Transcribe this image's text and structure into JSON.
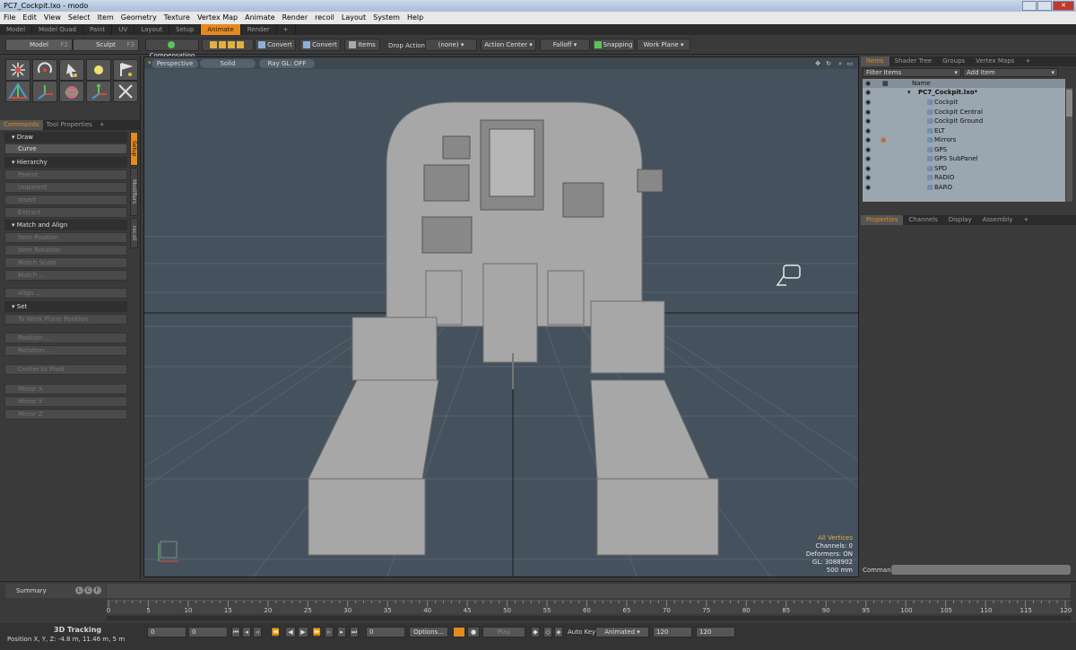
{
  "window": {
    "title": "PC7_Cockpit.lxo - modo"
  },
  "menu": [
    "File",
    "Edit",
    "View",
    "Select",
    "Item",
    "Geometry",
    "Texture",
    "Vertex Map",
    "Animate",
    "Render",
    "recoil",
    "Layout",
    "System",
    "Help"
  ],
  "layout_tabs": [
    "Model",
    "Model Quad",
    "Paint",
    "UV",
    "Layout",
    "Setup",
    "Animate",
    "Render",
    "+"
  ],
  "active_layout_tab": "Animate",
  "toolbar": {
    "model": "Model",
    "model_key": "F2",
    "sculpt": "Sculpt",
    "sculpt_key": "F3",
    "compensation": "Compensation",
    "convert1": "Convert",
    "convert2": "Convert",
    "items": "Items",
    "drop_action": "Drop Action",
    "none": "(none)",
    "action_center": "Action Center",
    "falloff": "Falloff",
    "snapping": "Snapping",
    "work_plane": "Work Plane"
  },
  "left": {
    "tabs": [
      "Commands",
      "Tool Properties",
      "+"
    ],
    "vtabs": [
      "Setup",
      "Modifiers",
      "recoil"
    ],
    "sections": {
      "draw": "Draw",
      "hierarchy": "Hierarchy",
      "match_align": "Match and Align",
      "set": "Set"
    },
    "commands": {
      "curve": "Curve",
      "parent": "Parent",
      "unparent": "Unparent",
      "insert": "Insert",
      "extract": "Extract",
      "item_position": "Item Position",
      "item_rotation": "Item Rotation",
      "match_scale": "Match Scale",
      "match": "Match ...",
      "align": "Align ...",
      "to_work_plane": "To Work Plane Position",
      "position": "Position ...",
      "rotation": "Rotation ...",
      "center_to_pivot": "Center to Pivot",
      "mirror_x": "Mirror X",
      "mirror_y": "Mirror Y",
      "mirror_z": "Mirror Z"
    }
  },
  "viewport": {
    "view": "Perspective",
    "shading": "Solid",
    "raygl": "Ray GL: OFF",
    "info": {
      "mode": "All Vertices",
      "channels": "Channels: 0",
      "deformers": "Deformers: ON",
      "gl": "GL: 3088902",
      "scale": "500 mm"
    }
  },
  "right": {
    "tabs": [
      "Items",
      "Shader Tree",
      "Groups",
      "Vertex Maps",
      "+"
    ],
    "filter": "Filter Items",
    "add_item": "Add Item",
    "name_header": "Name",
    "scene": "PC7_Cockpit.lxo*",
    "items": [
      "Cockpit",
      "Cockpit Central",
      "Cockpit Ground",
      "ELT",
      "Mirrors",
      "GPS",
      "GPS SubPanel",
      "SPD",
      "RADIO",
      "BARO"
    ],
    "prop_tabs": [
      "Properties",
      "Channels",
      "Display",
      "Assembly",
      "+"
    ],
    "command_label": "Command"
  },
  "timeline": {
    "summary": "Summary",
    "ticks": [
      "0",
      "5",
      "10",
      "15",
      "20",
      "25",
      "30",
      "35",
      "40",
      "45",
      "50",
      "55",
      "60",
      "65",
      "70",
      "75",
      "80",
      "85",
      "90",
      "95",
      "100",
      "105",
      "110",
      "115",
      "120"
    ]
  },
  "bottom": {
    "tracking": "3D Tracking",
    "position": "Position X, Y, Z:  -4.8 m, 11.46 m, 5 m",
    "field1": "0",
    "field2": "0",
    "field3": "0",
    "options": "Options...",
    "play": "Play",
    "auto_key": "Auto Key",
    "animated": "Animated",
    "end1": "120",
    "end2": "120"
  },
  "colors": {
    "accent": "#e58a1f",
    "viewport_bg": "#45525d",
    "grid": "#56636d"
  }
}
